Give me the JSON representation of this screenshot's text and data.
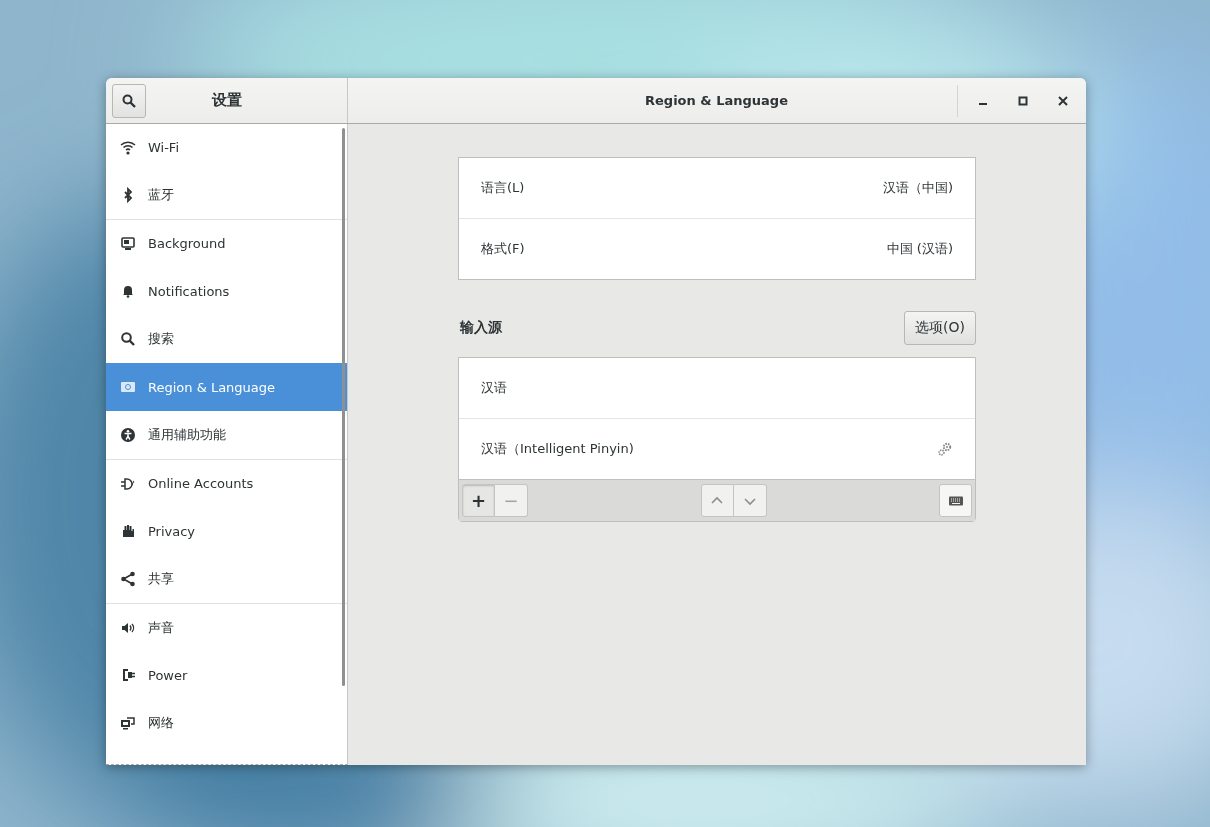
{
  "sidebar": {
    "title": "设置",
    "groups": [
      {
        "items": [
          {
            "label": "Wi-Fi",
            "selected": false
          },
          {
            "label": "蓝牙",
            "selected": false
          }
        ]
      },
      {
        "items": [
          {
            "label": "Background",
            "selected": false
          },
          {
            "label": "Notifications",
            "selected": false
          },
          {
            "label": "搜索",
            "selected": false
          },
          {
            "label": "Region & Language",
            "selected": true
          },
          {
            "label": "通用辅助功能",
            "selected": false
          }
        ]
      },
      {
        "items": [
          {
            "label": "Online Accounts",
            "selected": false
          },
          {
            "label": "Privacy",
            "selected": false
          },
          {
            "label": "共享",
            "selected": false
          }
        ]
      },
      {
        "items": [
          {
            "label": "声音",
            "selected": false
          },
          {
            "label": "Power",
            "selected": false
          },
          {
            "label": "网络",
            "selected": false
          }
        ]
      }
    ]
  },
  "window": {
    "title": "Region & Language"
  },
  "settings": [
    {
      "label": "语言(L)",
      "value": "汉语（中国)"
    },
    {
      "label": "格式(F)",
      "value": "中国 (汉语)"
    }
  ],
  "input_sources": {
    "heading": "输入源",
    "options_button": "选项(O)",
    "items": [
      {
        "label": "汉语",
        "has_settings": false
      },
      {
        "label": "汉语（Intelligent Pinyin)",
        "has_settings": true
      }
    ],
    "toolbar": [
      {
        "kind": "add",
        "label": "+",
        "disabled": false
      },
      {
        "kind": "remove",
        "label": "−",
        "disabled": true
      },
      {
        "kind": "up",
        "disabled": true
      },
      {
        "kind": "down",
        "disabled": true
      },
      {
        "kind": "keyboard",
        "disabled": false
      }
    ]
  }
}
